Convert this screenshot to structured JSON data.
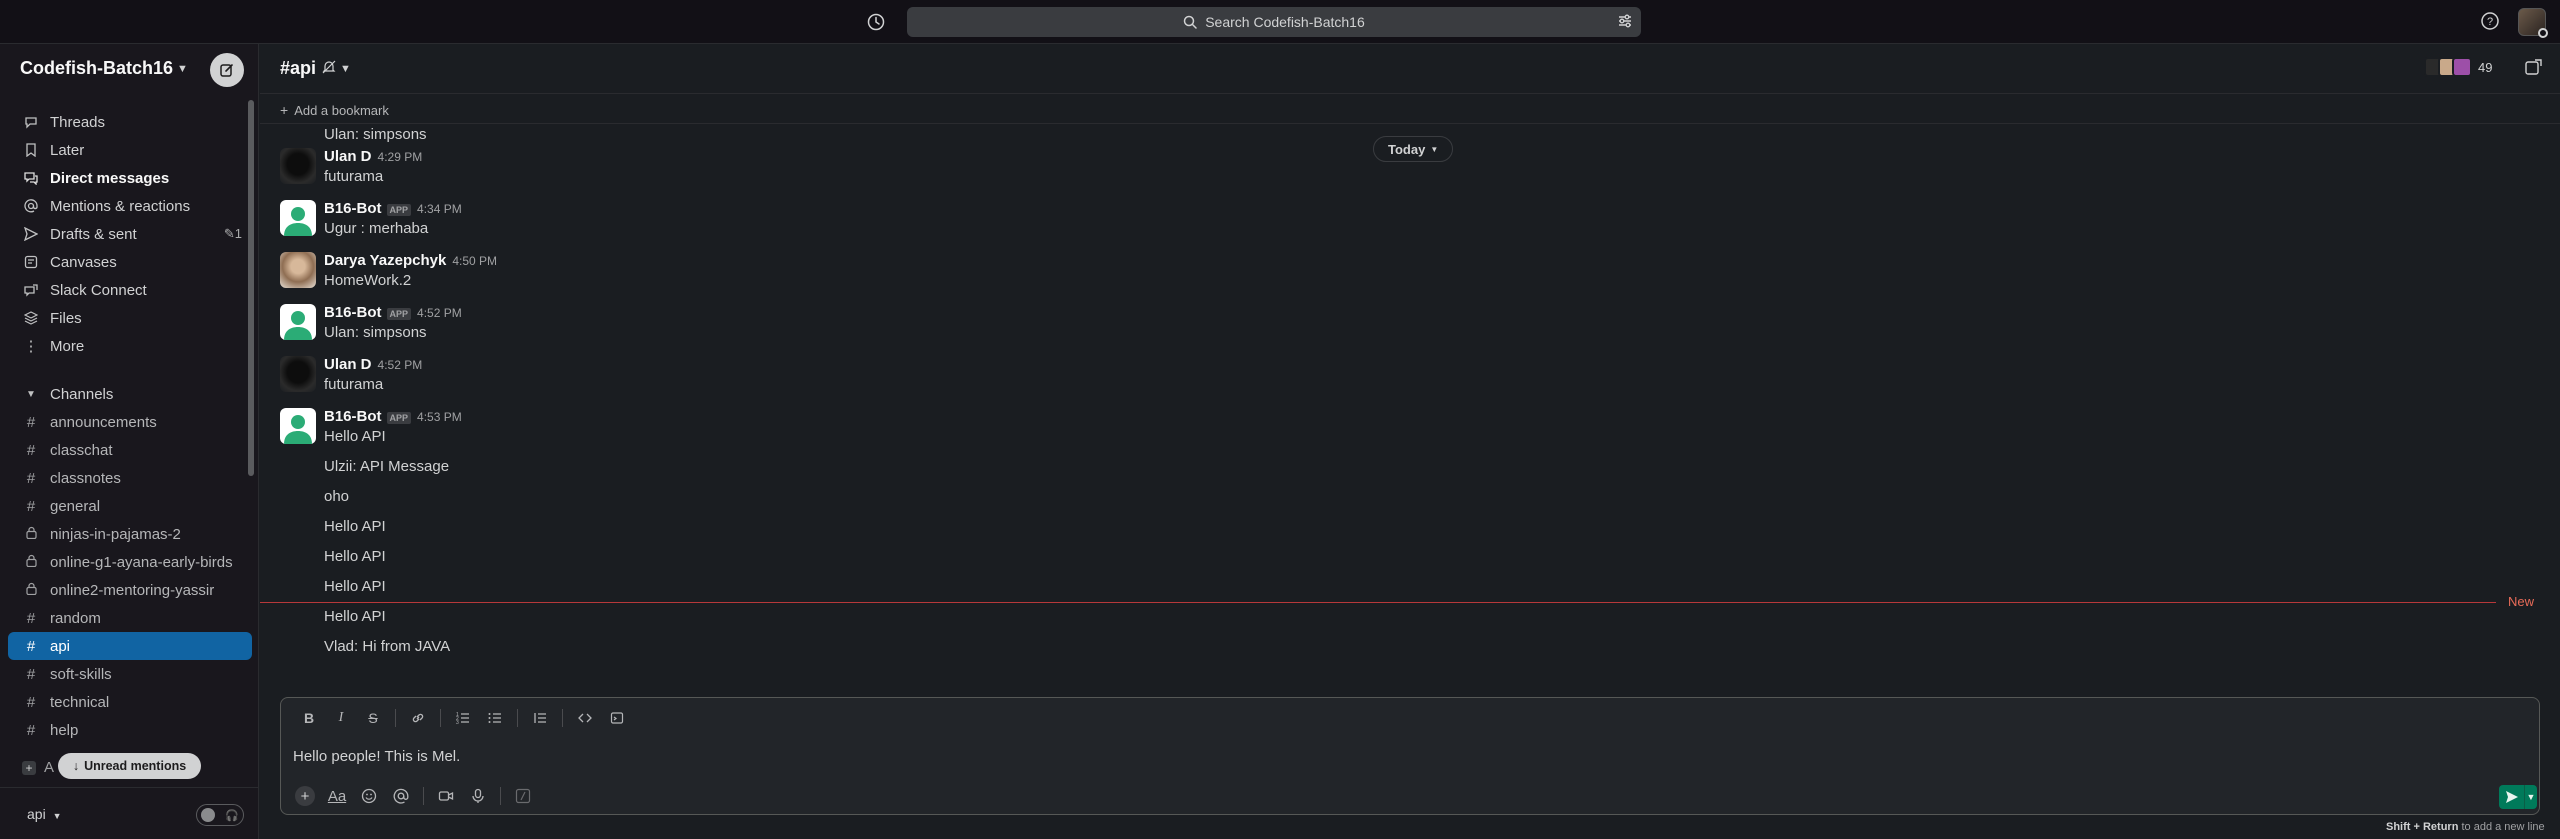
{
  "topbar": {
    "search_placeholder": "Search Codefish-Batch16"
  },
  "workspace": {
    "name": "Codefish-Batch16"
  },
  "sidebar": {
    "nav": [
      {
        "label": "Threads",
        "icon": "threads-icon"
      },
      {
        "label": "Later",
        "icon": "bookmark-icon"
      },
      {
        "label": "Direct messages",
        "icon": "direct-messages-icon"
      },
      {
        "label": "Mentions & reactions",
        "icon": "at-icon"
      },
      {
        "label": "Drafts & sent",
        "icon": "send-icon",
        "badge": "1"
      },
      {
        "label": "Canvases",
        "icon": "canvas-icon"
      },
      {
        "label": "Slack Connect",
        "icon": "slack-connect-icon"
      },
      {
        "label": "Files",
        "icon": "files-icon"
      },
      {
        "label": "More",
        "icon": "more-icon"
      }
    ],
    "channels_label": "Channels",
    "channels": [
      {
        "name": "announcements",
        "type": "public"
      },
      {
        "name": "classchat",
        "type": "public"
      },
      {
        "name": "classnotes",
        "type": "public"
      },
      {
        "name": "general",
        "type": "public"
      },
      {
        "name": "ninjas-in-pajamas-2",
        "type": "private"
      },
      {
        "name": "online-g1-ayana-early-birds",
        "type": "private"
      },
      {
        "name": "online2-mentoring-yassir",
        "type": "private"
      },
      {
        "name": "random",
        "type": "public"
      },
      {
        "name": "api",
        "type": "public",
        "active": true
      },
      {
        "name": "soft-skills",
        "type": "public"
      },
      {
        "name": "technical",
        "type": "public"
      },
      {
        "name": "help",
        "type": "public"
      }
    ],
    "add_channels_partial": "A",
    "unread_mentions": "Unread mentions",
    "footer_channel": "api"
  },
  "channel": {
    "name": "api",
    "member_count": "49",
    "bookmark_label": "Add a bookmark",
    "date_divider": "Today",
    "new_label": "New"
  },
  "messages": {
    "top_text": "Ulan: simpsons",
    "groups": [
      {
        "author": "Ulan D",
        "time": "4:29 PM",
        "lines": [
          "futurama"
        ],
        "app": false,
        "avatar": "dark"
      },
      {
        "author": "B16-Bot",
        "time": "4:34 PM",
        "lines": [
          "Ugur : merhaba"
        ],
        "app": true,
        "avatar": "bot"
      },
      {
        "author": "Darya Yazepchyk",
        "time": "4:50 PM",
        "lines": [
          "HomeWork.2"
        ],
        "app": false,
        "avatar": "darya"
      },
      {
        "author": "B16-Bot",
        "time": "4:52 PM",
        "lines": [
          "Ulan: simpsons"
        ],
        "app": true,
        "avatar": "bot"
      },
      {
        "author": "Ulan D",
        "time": "4:52 PM",
        "lines": [
          "futurama"
        ],
        "app": false,
        "avatar": "dark"
      },
      {
        "author": "B16-Bot",
        "time": "4:53 PM",
        "lines": [
          "Hello API"
        ],
        "app": true,
        "avatar": "bot"
      }
    ],
    "continuation": [
      "Ulzii: API Message",
      "oho",
      "Hello API",
      "Hello API",
      "Hello API",
      "Hello API",
      "Vlad: Hi from JAVA"
    ],
    "app_badge": "APP"
  },
  "composer": {
    "text": "Hello people! This is Mel.",
    "hint_keys": "Shift + Return",
    "hint_rest": "to add a new line"
  },
  "colors": {
    "accent": "#1164a3",
    "send": "#007a5a",
    "new_divider": "#b7383a"
  }
}
